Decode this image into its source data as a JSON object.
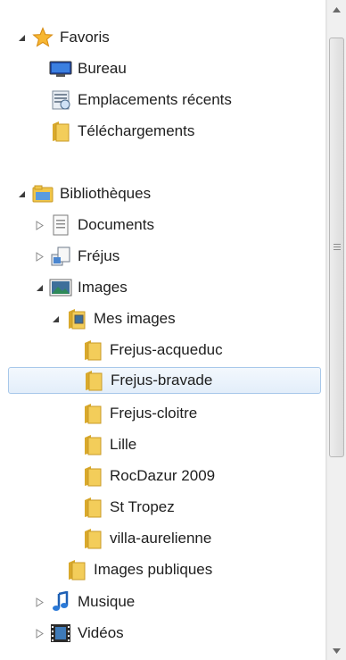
{
  "tree": {
    "favorites": {
      "label": "Favoris",
      "icon": "star-icon",
      "items": [
        {
          "label": "Bureau",
          "icon": "desktop-icon"
        },
        {
          "label": "Emplacements récents",
          "icon": "recent-places-icon"
        },
        {
          "label": "Téléchargements",
          "icon": "folder-icon"
        }
      ]
    },
    "libraries": {
      "label": "Bibliothèques",
      "icon": "libraries-icon",
      "items": [
        {
          "label": "Documents",
          "icon": "documents-icon",
          "expanded": false
        },
        {
          "label": "Fréjus",
          "icon": "library-icon",
          "expanded": false
        },
        {
          "label": "Images",
          "icon": "pictures-icon",
          "expanded": true,
          "children": [
            {
              "label": "Mes images",
              "icon": "my-pictures-icon",
              "expanded": true,
              "children": [
                {
                  "label": "Frejus-acqueduc",
                  "icon": "folder-icon"
                },
                {
                  "label": "Frejus-bravade",
                  "icon": "folder-icon",
                  "selected": true
                },
                {
                  "label": "Frejus-cloitre",
                  "icon": "folder-icon"
                },
                {
                  "label": "Lille",
                  "icon": "folder-icon"
                },
                {
                  "label": "RocDazur 2009",
                  "icon": "folder-icon"
                },
                {
                  "label": "St Tropez",
                  "icon": "folder-icon"
                },
                {
                  "label": "villa-aurelienne",
                  "icon": "folder-icon"
                }
              ]
            },
            {
              "label": "Images publiques",
              "icon": "folder-icon"
            }
          ]
        },
        {
          "label": "Musique",
          "icon": "music-icon",
          "expanded": false
        },
        {
          "label": "Vidéos",
          "icon": "videos-icon",
          "expanded": false
        }
      ]
    }
  },
  "colors": {
    "selection_bg": "#e3eefa",
    "selection_border": "#a8c8ea",
    "folder": "#f0c64a"
  }
}
